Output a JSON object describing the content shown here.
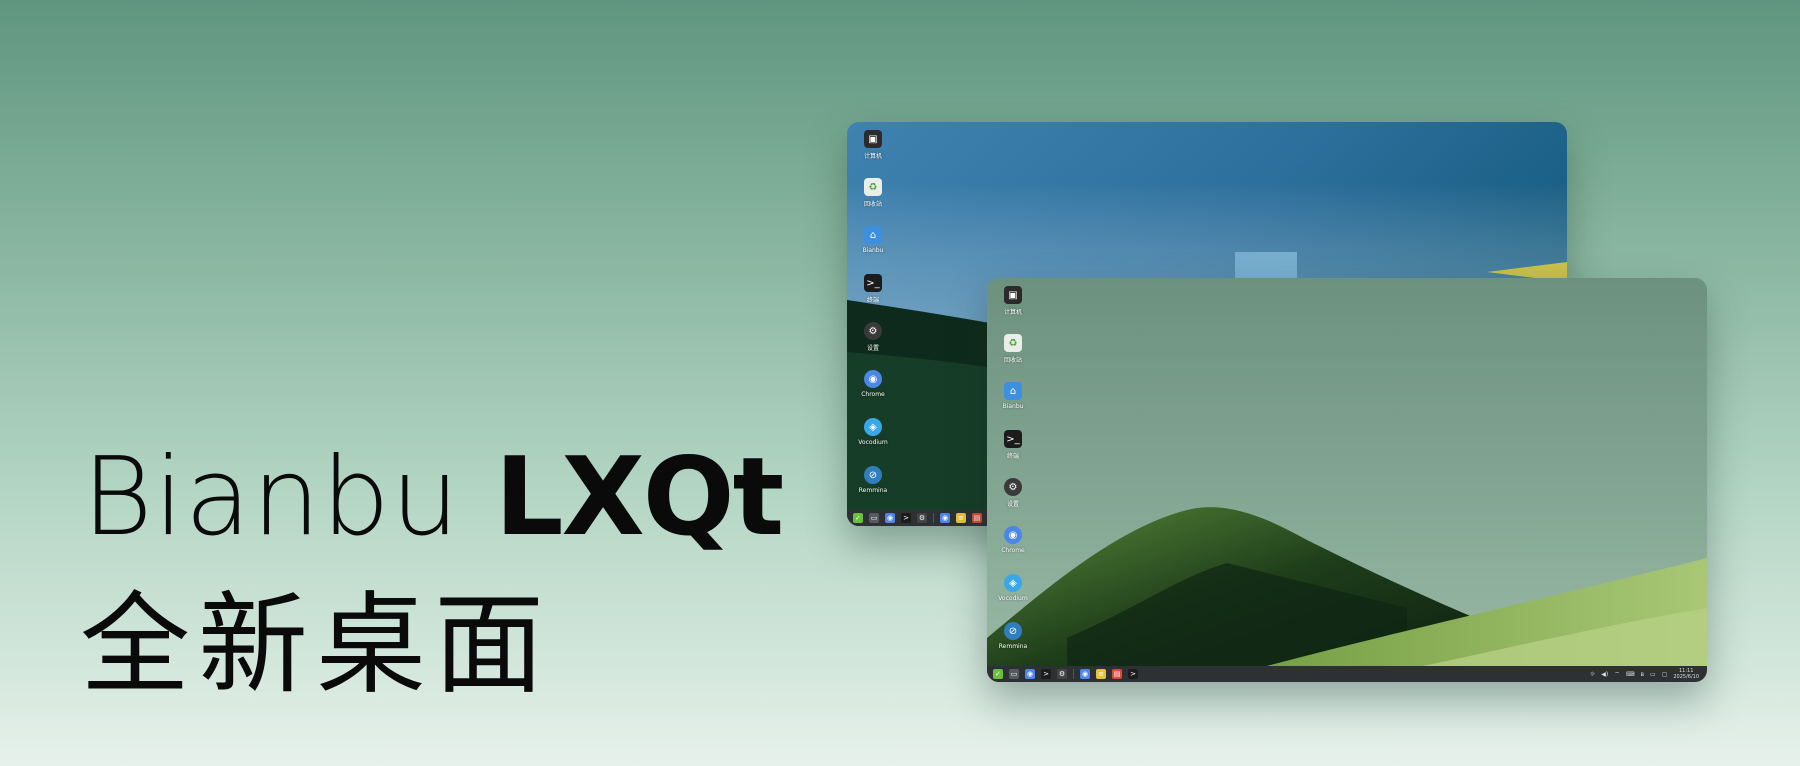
{
  "headline": {
    "brand_light": "Bianbu",
    "brand_bold": "LXQt",
    "subtitle": "全新桌面"
  },
  "desktop_icons": [
    {
      "label": "计算机",
      "icon": "computer-icon",
      "color": "#2b2b2b",
      "glyph": "▣"
    },
    {
      "label": "回收站",
      "icon": "trash-icon",
      "color": "#e9efe6",
      "glyph": "♻"
    },
    {
      "label": "Bianbu",
      "icon": "folder-icon",
      "color": "#3d8fe0",
      "glyph": "⌂"
    },
    {
      "label": "终端",
      "icon": "terminal-icon",
      "color": "#1c1c1c",
      "glyph": ">_"
    },
    {
      "label": "设置",
      "icon": "settings-icon",
      "color": "#3a3a3a",
      "glyph": "⚙"
    },
    {
      "label": "Chrome",
      "icon": "chrome-icon",
      "color": "#4b86e8",
      "glyph": "◉"
    },
    {
      "label": "Vocodium",
      "icon": "vscodium-icon",
      "color": "#3aa8e8",
      "glyph": "◈"
    },
    {
      "label": "Remmina",
      "icon": "remmina-icon",
      "color": "#2f7fbf",
      "glyph": "⊘"
    }
  ],
  "taskbar": {
    "apps": [
      {
        "icon": "bianbu-menu-icon",
        "color": "#6bbf3a",
        "glyph": "✓"
      },
      {
        "icon": "show-desktop-icon",
        "color": "#555a5e",
        "glyph": "▭"
      },
      {
        "icon": "chrome-icon",
        "color": "#4b86e8",
        "glyph": "◉"
      },
      {
        "icon": "terminal-icon",
        "color": "#1c1c1c",
        "glyph": ">"
      },
      {
        "icon": "settings-icon",
        "color": "#444",
        "glyph": "⚙"
      }
    ],
    "running": [
      {
        "icon": "chrome-icon",
        "color": "#4b86e8",
        "glyph": "◉"
      },
      {
        "icon": "notes-icon",
        "color": "#e8c040",
        "glyph": "≡"
      },
      {
        "icon": "document-icon",
        "color": "#d94a3a",
        "glyph": "▤"
      },
      {
        "icon": "terminal-icon",
        "color": "#1c1c1c",
        "glyph": ">"
      }
    ],
    "tray": [
      {
        "icon": "brightness-icon",
        "glyph": "☼"
      },
      {
        "icon": "volume-icon",
        "glyph": "◀)"
      },
      {
        "icon": "wifi-icon",
        "glyph": "⌔"
      },
      {
        "icon": "keyboard-icon",
        "glyph": "⌨"
      },
      {
        "icon": "bluetooth-icon",
        "glyph": "ʙ"
      },
      {
        "icon": "battery-icon",
        "glyph": "▭"
      },
      {
        "icon": "notification-icon",
        "glyph": "▢"
      }
    ],
    "clock_time": "11:11",
    "clock_date": "2025/6/10"
  }
}
